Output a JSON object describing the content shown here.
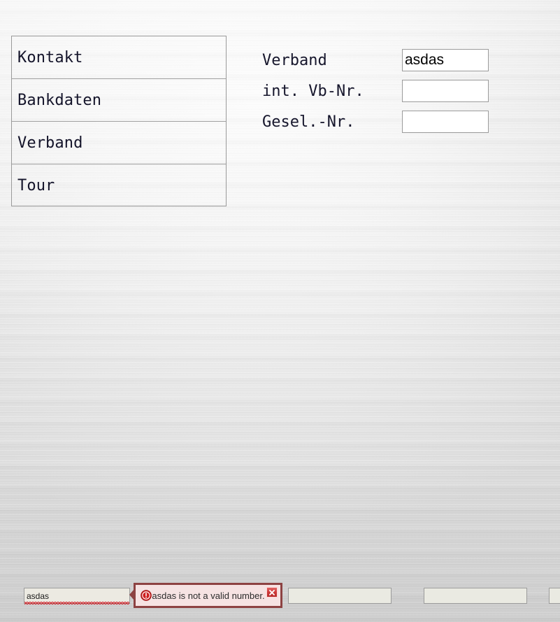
{
  "nav_panel": {
    "items": [
      {
        "label": "Kontakt"
      },
      {
        "label": "Bankdaten"
      },
      {
        "label": "Verband"
      },
      {
        "label": "Tour"
      }
    ]
  },
  "verband_form": {
    "rows": [
      {
        "label": "Verband",
        "value": "asdas",
        "placeholder": ""
      },
      {
        "label": "int. Vb-Nr.",
        "value": "",
        "placeholder": ""
      },
      {
        "label": "Gesel.-Nr.",
        "value": "",
        "placeholder": ""
      }
    ]
  },
  "bottom_strip": {
    "inputs": [
      {
        "value": "asdas",
        "placeholder": ""
      },
      {
        "value": "",
        "placeholder": ""
      },
      {
        "value": "",
        "placeholder": ""
      },
      {
        "value": "",
        "placeholder": ""
      }
    ]
  },
  "error_tooltip": {
    "message": "asdas is not a valid number.",
    "icon": "error-circle-icon",
    "close_icon": "close-icon",
    "border_color": "#8d4242",
    "background_color": "#f6e3e3",
    "icon_color": "#cc2020"
  },
  "colors": {
    "panel_border": "#9a9a9a",
    "separator": "#a2a2a2",
    "input_border": "#9b9b9b",
    "input_fill_white": "#ffffff",
    "input_fill_flat": "#eaeae2",
    "squiggle": "#d0222a",
    "text": "#16162c"
  }
}
